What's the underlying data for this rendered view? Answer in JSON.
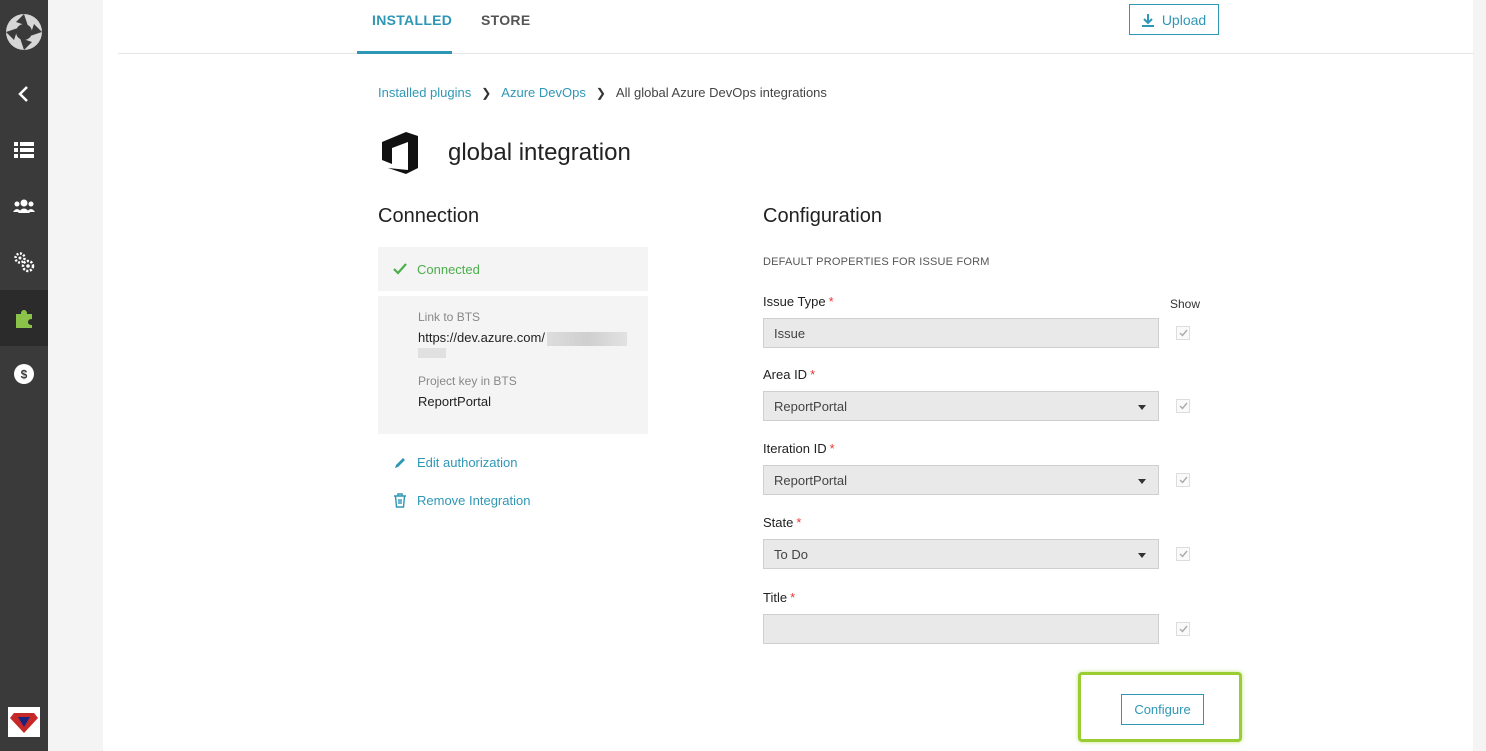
{
  "tabs": {
    "installed": "INSTALLED",
    "store": "STORE"
  },
  "upload_label": "Upload",
  "breadcrumb": {
    "item1": "Installed plugins",
    "item2": "Azure DevOps",
    "current": "All global Azure DevOps integrations"
  },
  "page_title": "global integration",
  "connection": {
    "title": "Connection",
    "status": "Connected",
    "link_label": "Link to BTS",
    "link_value": "https://dev.azure.com/",
    "project_key_label": "Project key in BTS",
    "project_key_value": "ReportPortal",
    "edit_label": "Edit authorization",
    "remove_label": "Remove Integration"
  },
  "configuration": {
    "title": "Configuration",
    "subtitle": "DEFAULT PROPERTIES FOR ISSUE FORM",
    "show_label": "Show",
    "required_mark": "*",
    "fields": [
      {
        "label": "Issue Type",
        "value": "Issue"
      },
      {
        "label": "Area ID",
        "value": "ReportPortal"
      },
      {
        "label": "Iteration ID",
        "value": "ReportPortal"
      },
      {
        "label": "State",
        "value": "To Do"
      },
      {
        "label": "Title",
        "value": ""
      }
    ],
    "configure_label": "Configure"
  },
  "colors": {
    "accent": "#2f97b6",
    "success": "#4cae4c",
    "highlight": "#9acd32",
    "sidebar": "#3a3a3a"
  }
}
